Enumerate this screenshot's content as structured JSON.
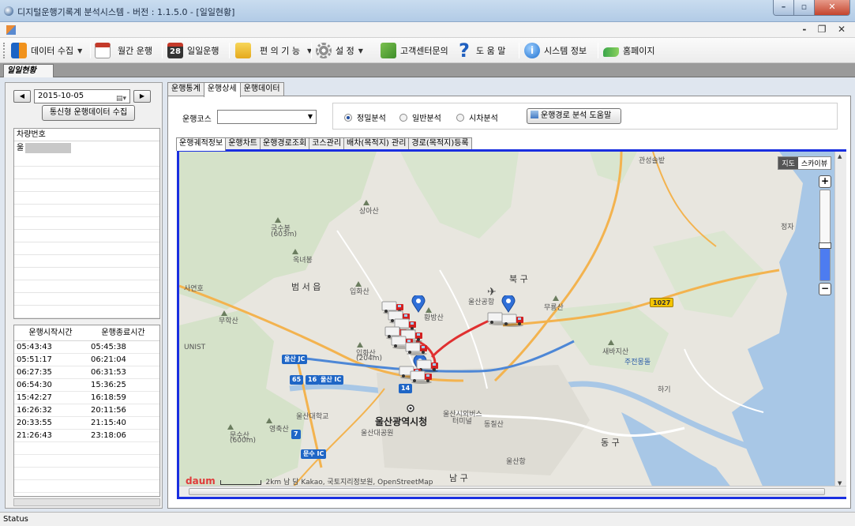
{
  "window": {
    "title": "디지털운행기록계 분석시스템 -  버전 : 1.1.5.0 - [일일현황]"
  },
  "toolbar": {
    "items": [
      {
        "label": "데이터 수집",
        "icon": "data-collect-icon",
        "dropdown": true
      },
      {
        "label": "월간 운행",
        "icon": "calendar-icon",
        "dropdown": false
      },
      {
        "label": "일일운행",
        "icon": "calendar-28-icon",
        "dropdown": false,
        "icon_text": "28"
      },
      {
        "label": "편 의 기 능",
        "icon": "folder-icon",
        "dropdown": true
      },
      {
        "label": "설    정",
        "icon": "gear-icon",
        "dropdown": true
      },
      {
        "label": "고객센터문의",
        "icon": "customer-center-icon",
        "dropdown": false
      },
      {
        "label": "도 움 말",
        "icon": "help-icon",
        "dropdown": false
      },
      {
        "label": "시스템 정보",
        "icon": "info-icon",
        "dropdown": false
      },
      {
        "label": "홈페이지",
        "icon": "homepage-icon",
        "dropdown": false
      }
    ]
  },
  "doc_tab": {
    "label": "일일현황"
  },
  "left": {
    "date": "2015-10-05",
    "collect_button": "통신형 운행데이터 수집",
    "vehicle_header": "차량번호",
    "vehicles": [
      {
        "prefix": "울"
      }
    ],
    "time_headers": {
      "start": "운행시작시간",
      "end": "운행종료시간"
    },
    "times": [
      {
        "start": "05:43:43",
        "end": "05:45:38"
      },
      {
        "start": "05:51:17",
        "end": "06:21:04"
      },
      {
        "start": "06:27:35",
        "end": "06:31:53"
      },
      {
        "start": "06:54:30",
        "end": "15:36:25"
      },
      {
        "start": "15:42:27",
        "end": "16:18:59"
      },
      {
        "start": "16:26:32",
        "end": "20:11:56"
      },
      {
        "start": "20:33:55",
        "end": "21:15:40"
      },
      {
        "start": "21:26:43",
        "end": "23:18:06"
      }
    ]
  },
  "main_tabs": [
    {
      "label": "운행통계",
      "active": false
    },
    {
      "label": "운행상세",
      "active": true
    },
    {
      "label": "운행데이터",
      "active": false
    }
  ],
  "course": {
    "label": "운행코스",
    "value": ""
  },
  "analysis": {
    "options": [
      {
        "label": "정밀분석",
        "selected": true
      },
      {
        "label": "일반분석",
        "selected": false
      },
      {
        "label": "시차분석",
        "selected": false
      }
    ],
    "help_button": "운행경로 분석 도움말"
  },
  "sub_tabs": [
    {
      "label": "운행궤적정보",
      "active": true
    },
    {
      "label": "운행차트",
      "active": false
    },
    {
      "label": "운행경로조회",
      "active": false
    },
    {
      "label": "코스관리",
      "active": false
    },
    {
      "label": "배차(목적지) 관리",
      "active": false
    },
    {
      "label": "경로(목적지)등록",
      "active": false
    }
  ],
  "map": {
    "type_buttons": {
      "map": "지도",
      "skyview": "스카이뷰"
    },
    "zoom_in": "+",
    "zoom_out": "−",
    "labels": {
      "l1": "관성솔밭",
      "l2": "상아산",
      "l3": "국수봉",
      "l3b": "(603m)",
      "l4": "정자",
      "l5": "옥녀봉",
      "l6": "범 서 읍",
      "l7": "북 구",
      "l8": "사연호",
      "l9": "입화산",
      "l10": "울산공항",
      "l11": "무룡산",
      "l12": "무학산",
      "l13": "황방산",
      "l14": "UNIST",
      "l15": "입화산",
      "l15b": "(204m)",
      "l16": "새바지산",
      "l17": "주전몽돌",
      "l18": "울산대학교",
      "l19": "울산광역시청",
      "l20": "울산시외버스",
      "l20b": "터미널",
      "l21": "동 구",
      "l22": "문수산",
      "l22b": "(600m)",
      "l23": "영축산",
      "l24": "울산대공원",
      "l25": "울산항",
      "l26": "남 구",
      "l27": "동칠산",
      "l28": "하기"
    },
    "badges": {
      "b1": "1027",
      "b2": "울산 JC",
      "b3": "울산 IC",
      "b4": "65",
      "b5": "16",
      "b6": "14",
      "b7": "7",
      "b8": "문수 IC"
    },
    "attribution": {
      "logo": "daum",
      "scale": "2km",
      "text": "Kakao, 국토지리정보원, OpenStreetMap",
      "partial": "남 담"
    }
  },
  "status": "Status",
  "colors": {
    "map_frame": "#1a2fe0",
    "route": "#e03030",
    "pin": "#2f6fd8",
    "truck": "#d32020"
  }
}
